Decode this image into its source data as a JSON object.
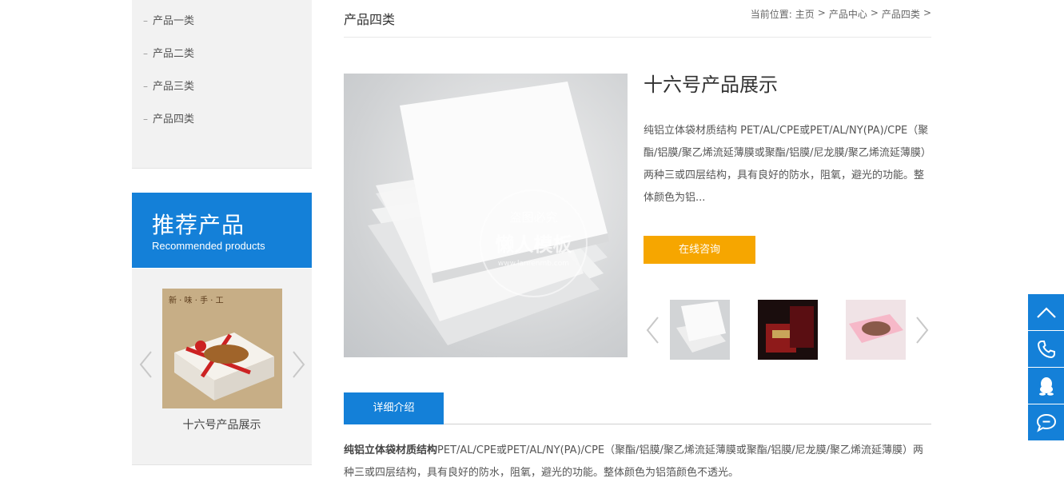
{
  "sidebar": {
    "categories": [
      {
        "dash": "–",
        "label": "产品一类"
      },
      {
        "dash": "–",
        "label": "产品二类"
      },
      {
        "dash": "–",
        "label": "产品三类"
      },
      {
        "dash": "–",
        "label": "产品四类"
      }
    ],
    "recommended": {
      "title": "推荐产品",
      "subtitle": "Recommended products",
      "item_caption": "十六号产品展示"
    }
  },
  "header": {
    "page_title": "产品四类",
    "breadcrumb": {
      "prefix": "当前位置:",
      "items": [
        "主页",
        "产品中心",
        "产品四类"
      ],
      "separator": ">"
    }
  },
  "product": {
    "title": "十六号产品展示",
    "summary": "纯铝立体袋材质结构 PET/AL/CPE或PET/AL/NY(PA)/CPE（聚酯/铝膜/聚乙烯流延薄膜或聚酯/铝膜/尼龙膜/聚乙烯流延薄膜）两种三或四层结构，具有良好的防水，阻氧，避光的功能。整体颜色为铝...",
    "consult_label": "在线咨询",
    "watermark": {
      "line1": "盗图必究",
      "line2": "懒人模板",
      "line3": "www.lanrenmb.com"
    }
  },
  "tabs": {
    "active_label": "详细介绍"
  },
  "detail": {
    "bold_lead": "纯铝立体袋材质结构",
    "text": "PET/AL/CPE或PET/AL/NY(PA)/CPE（聚酯/铝膜/聚乙烯流延薄膜或聚酯/铝膜/尼龙膜/聚乙烯流延薄膜）两种三或四层结构，具有良好的防水，阻氧，避光的功能。整体颜色为铝箔颜色不透光。"
  },
  "float_bar": {
    "icons": [
      "chevron-up-icon",
      "phone-icon",
      "qq-icon",
      "chat-icon"
    ]
  },
  "colors": {
    "accent": "#1480d8",
    "button": "#f6a600",
    "sidebar_bg": "#f2f2f2"
  }
}
